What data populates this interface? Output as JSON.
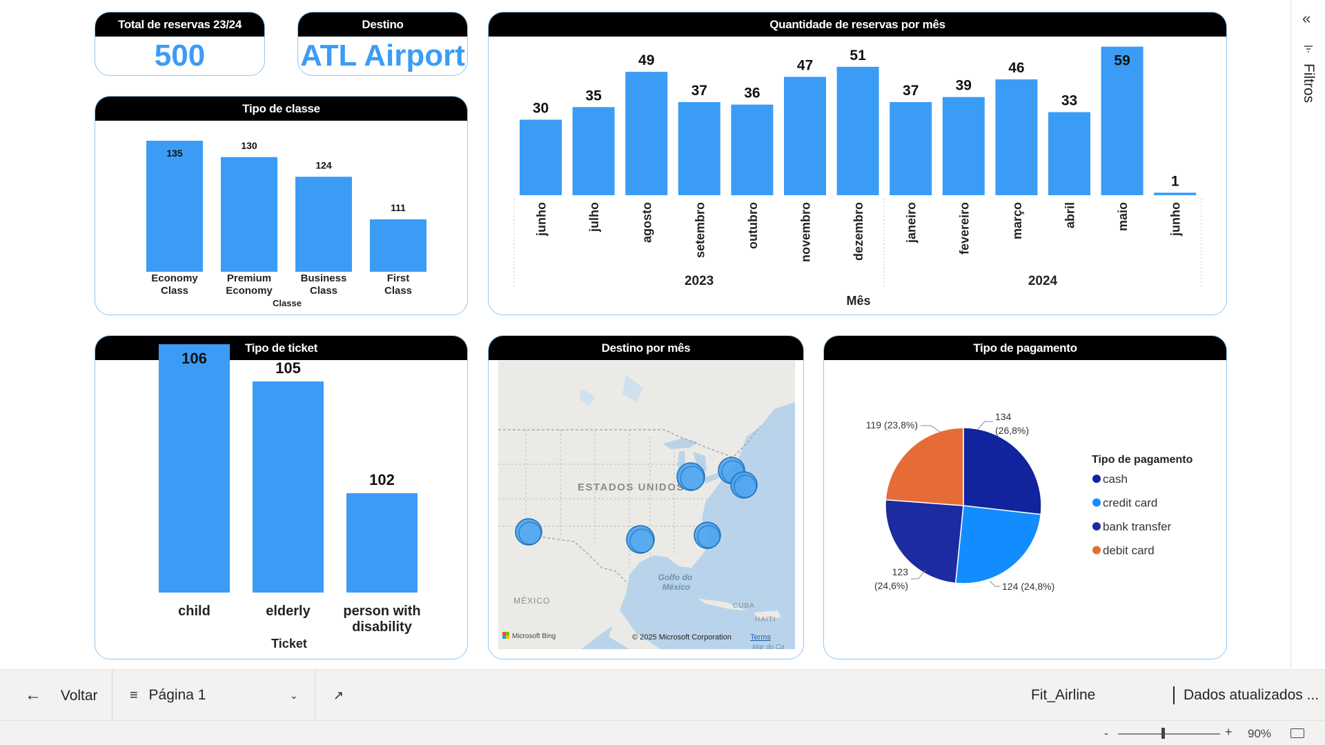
{
  "kpis": {
    "total": {
      "title": "Total de reservas 23/24",
      "value": "500"
    },
    "destino": {
      "title": "Destino",
      "value": "ATL Airport"
    }
  },
  "cards": {
    "classe": "Tipo de classe",
    "meses": "Quantidade de reservas por mês",
    "ticket": "Tipo de ticket",
    "mapa": "Destino por mês",
    "pagamento": "Tipo de pagamento"
  },
  "chart_data": [
    {
      "type": "bar",
      "title": "Tipo de classe",
      "categories": [
        "Economy Class",
        "Premium Economy",
        "Business Class",
        "First Class"
      ],
      "values": [
        135,
        130,
        124,
        111
      ],
      "xlabel": "Classe",
      "ylabel": "",
      "color": "#3b9cf6"
    },
    {
      "type": "bar",
      "title": "Quantidade de reservas por mês",
      "categories": [
        "junho",
        "julho",
        "agosto",
        "setembro",
        "outubro",
        "novembro",
        "dezembro",
        "janeiro",
        "fevereiro",
        "março",
        "abril",
        "maio",
        "junho"
      ],
      "years": [
        {
          "label": "2023",
          "count": 7
        },
        {
          "label": "2024",
          "count": 6
        }
      ],
      "values": [
        30,
        35,
        49,
        37,
        36,
        47,
        51,
        37,
        39,
        46,
        33,
        59,
        1
      ],
      "xlabel": "Mês",
      "ylabel": "",
      "color": "#3b9cf6"
    },
    {
      "type": "bar",
      "title": "Tipo de ticket",
      "categories": [
        "child",
        "elderly",
        "person with disability"
      ],
      "values": [
        106,
        105,
        102
      ],
      "xlabel": "Ticket",
      "ylabel": "",
      "color": "#3b9cf6"
    },
    {
      "type": "pie",
      "title": "Tipo de pagamento",
      "legend_title": "Tipo de pagamento",
      "legend_position": "right",
      "slices": [
        {
          "label": "cash",
          "value": 134,
          "text": "134 (26,8%)",
          "color": "#12239e"
        },
        {
          "label": "credit card",
          "value": 124,
          "text": "124 (24,8%)",
          "color": "#118dff"
        },
        {
          "label": "bank transfer",
          "value": 123,
          "text": "123 (24,6%)",
          "color": "#1c2ba0"
        },
        {
          "label": "debit card",
          "value": 119,
          "text": "119 (23,8%)",
          "color": "#e66c37"
        }
      ]
    }
  ],
  "map": {
    "labels": {
      "country_us": "ESTADOS UNIDOS",
      "country_mx": "MÉXICO",
      "gulf": "Golfo do México",
      "cuba": "CUBA",
      "haiti": "HAITI",
      "sea": "Mar do Ca"
    },
    "attribution": "© 2025 Microsoft Corporation",
    "terms": "Terms",
    "provider": "Microsoft Bing",
    "bubble_color": "#4aa3f0"
  },
  "sidebar": {
    "collapse_icon": "«",
    "filters_label": "Filtros"
  },
  "footer": {
    "back_label": "Voltar",
    "page_label": "Página 1",
    "report_name": "Fit_Airline",
    "refresh_label": "Dados atualizados ...",
    "zoom_minus": "-",
    "zoom_plus": "+",
    "zoom_value": "90%"
  }
}
